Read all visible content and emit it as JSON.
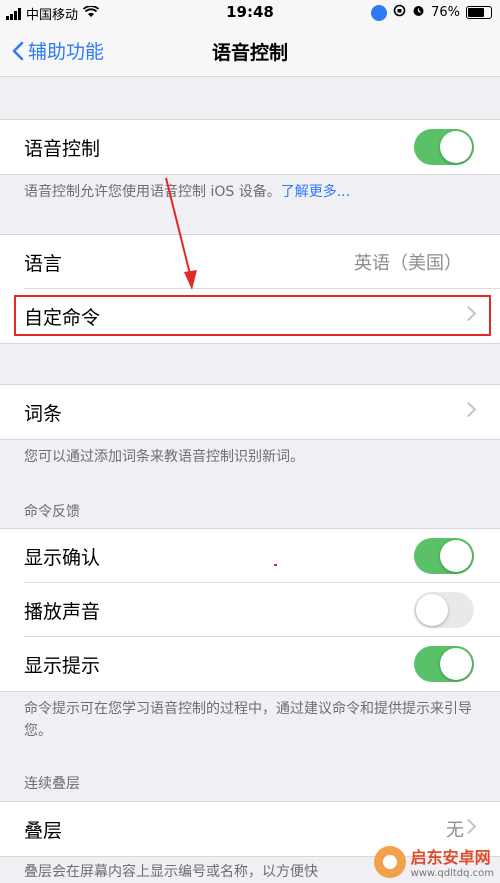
{
  "status_bar": {
    "carrier": "中国移动",
    "time": "19:48",
    "battery": "76%"
  },
  "nav": {
    "back_label": "辅助功能",
    "title": "语音控制"
  },
  "voice_control": {
    "label": "语音控制",
    "enabled": true,
    "footer_text": "语音控制允许您使用语音控制 iOS 设备。",
    "learn_more": "了解更多..."
  },
  "language": {
    "label": "语言",
    "value": "英语（美国）"
  },
  "custom_commands": {
    "label": "自定命令"
  },
  "vocabulary": {
    "label": "词条",
    "footer": "您可以通过添加词条来教语音控制识别新词。"
  },
  "command_feedback": {
    "header": "命令反馈",
    "items": [
      {
        "label": "显示确认",
        "enabled": true
      },
      {
        "label": "播放声音",
        "enabled": false
      },
      {
        "label": "显示提示",
        "enabled": true
      }
    ],
    "footer": "命令提示可在您学习语音控制的过程中，通过建议命令和提供提示来引导您。"
  },
  "continuous_overlay": {
    "header": "连续叠层",
    "label": "叠层",
    "value": "无",
    "footer": "叠层会在屏幕内容上显示编号或名称，以方便快"
  },
  "watermark": {
    "name": "启东安卓网",
    "url": "www.qdltdq.com"
  },
  "colors": {
    "accent": "#2f7bf6",
    "toggle_on": "#5ac168",
    "highlight": "#e02a2a"
  }
}
